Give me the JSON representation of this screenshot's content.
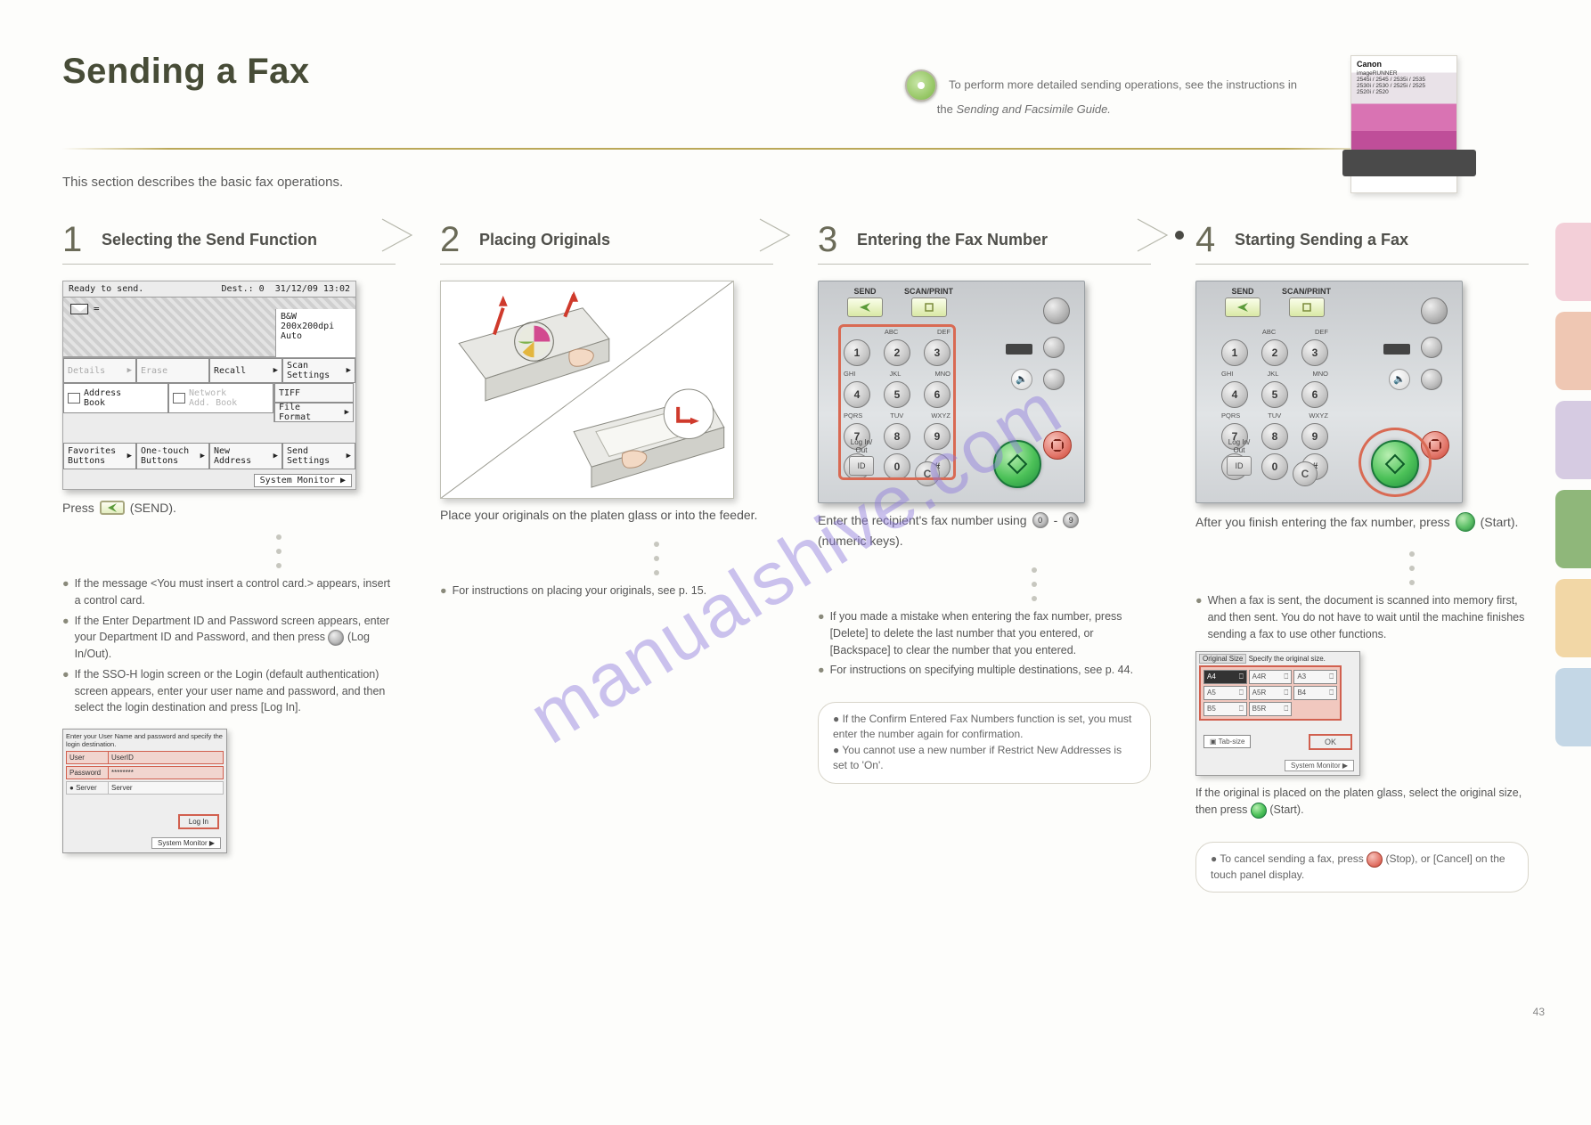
{
  "header": {
    "title": "Sending a Fax",
    "ref_line1": "To perform more detailed sending operations, see the instructions in",
    "ref_line2_a": "the",
    "ref_line2_b": "Sending and Facsimile Guide."
  },
  "booklet": {
    "brand": "Canon",
    "model_lines": "imageRUNNER\n2545i / 2545 / 2535i / 2535\n2530i / 2530 / 2525i / 2525\n2520i / 2520"
  },
  "intro": "This section describes the basic fax operations.",
  "steps": [
    {
      "num": "1",
      "title": "Selecting the Send Function"
    },
    {
      "num": "2",
      "title": "Placing Originals"
    },
    {
      "num": "3",
      "title": "Entering the Fax Number"
    },
    {
      "num": "4",
      "title": "Starting Sending a Fax"
    }
  ],
  "screen1": {
    "topbar": {
      "ready": "Ready to send.",
      "dest": "Dest.:   0",
      "time": "31/12/09 13:02"
    },
    "eq": "=",
    "info": {
      "l1": "B&W",
      "l2": "200x200dpi",
      "l3": "Auto"
    },
    "btn_details": "Details",
    "btn_erase": "Erase",
    "btn_recall": "Recall",
    "btn_scan": "Scan\nSettings",
    "ab_book": "Address\nBook",
    "ab_net": "Network\nAdd. Book",
    "side_tiff": "TIFF",
    "side_file": "File\nFormat",
    "bot_fav": "Favorites\nButtons",
    "bot_one": "One-touch\nButtons",
    "bot_new": "New\nAddress",
    "bot_send": "Send\nSettings",
    "sys": "System Monitor"
  },
  "step1": {
    "instr_a": "Press",
    "instr_b": "(SEND).",
    "hint1": "If the message <You must insert a control card.> appears, insert a control card.",
    "hint2_a": "If the Enter Department ID and Password screen appears, enter your Department ID and Password, and then press",
    "hint2_b": "(Log In/Out).",
    "hint3": "If the SSO-H login screen or the Login (default authentication) screen appears, enter your user name and password, and then select the login destination and press [Log In]."
  },
  "login": {
    "prompt": "Enter your User Name and password and specify the login destination.",
    "lbl_user": "User",
    "val_user": "UserID",
    "lbl_pass": "Password",
    "val_pass": "********",
    "lbl_server": "Server",
    "val_server": "Server",
    "btn": "Log In",
    "sys": "System Monitor"
  },
  "step2": {
    "instr": "Place your originals on the platen glass or into the feeder.",
    "hint1_a": "For instructions on placing your originals, see p.",
    "hint1_b": "15",
    "hint1_c": "."
  },
  "panel_labels": {
    "send": "SEND",
    "scan": "SCAN/PRINT",
    "abc": "ABC",
    "def": "DEF",
    "ghi": "GHI",
    "jkl": "JKL",
    "mno": "MNO",
    "pqrs": "PQRS",
    "tuv": "TUV",
    "wxyz": "WXYZ",
    "id_top": "Log In/",
    "id_bot": "Out",
    "id": "ID",
    "c": "C",
    "keys": [
      "1",
      "2",
      "3",
      "4",
      "5",
      "6",
      "7",
      "8",
      "9",
      "*",
      "0",
      "#"
    ]
  },
  "step3": {
    "instr_a": "Enter the recipient's fax number using",
    "instr_b": "-",
    "instr_c": "(numeric keys).",
    "k0": "0",
    "k9": "9",
    "hint1": "If you made a mistake when entering the fax number, press [Delete] to delete the last number that you entered, or [Backspace] to clear the number that you entered.",
    "hint2_a": "For instructions on specifying multiple destinations, see p.",
    "hint2_b": "44",
    "hint2_c": ".",
    "note1": "If the Confirm Entered Fax Numbers function is set, you must enter the number again for confirmation.",
    "note2": "You cannot use a new number if Restrict New Addresses is set to 'On'."
  },
  "step4": {
    "instr_a": "After you finish entering the fax number, press",
    "instr_b": "(Start).",
    "hint1": "When a fax is sent, the document is scanned into memory first, and then sent. You do not have to wait until the machine finishes sending a fax to use other functions.",
    "sub_a": "If the original is placed on the platen glass, select the original size, then press",
    "sub_b": "(Start).",
    "note": "To cancel sending a fax, press",
    "note_b": "(Stop), or [Cancel] on the touch panel display."
  },
  "orig": {
    "title": "Specify the original size.",
    "tab": "Original Size",
    "cells": [
      [
        "A4",
        "⎕"
      ],
      [
        "A4R",
        "⎕"
      ],
      [
        "A3",
        "⎕"
      ],
      [
        "A5",
        "⎕"
      ],
      [
        "A5R",
        "⎕"
      ],
      [
        "B4",
        "⎕"
      ],
      [
        "B5",
        "⎕"
      ],
      [
        "B5R",
        "⎕"
      ],
      [
        "",
        ""
      ]
    ],
    "tabb": "Tab-size",
    "ok": "OK",
    "sys": "System Monitor"
  },
  "edge_colors": [
    "#f3cfd8",
    "#efc7b3",
    "#d6cbe2",
    "#8fb77a",
    "#f2d7a6",
    "#c4d7e6"
  ],
  "page_num": "43",
  "watermark": "manualshive.com"
}
